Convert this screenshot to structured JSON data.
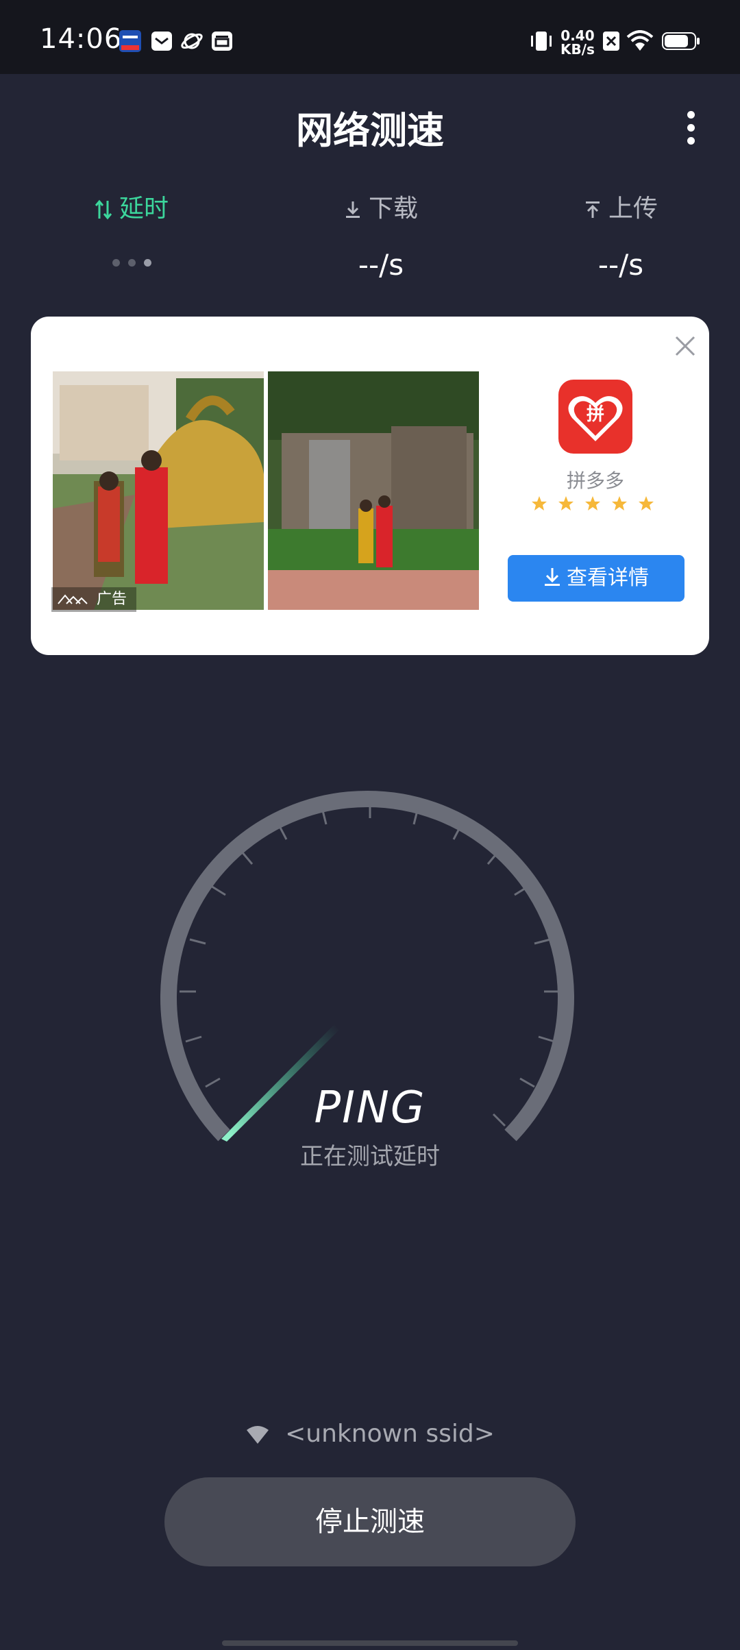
{
  "status_bar": {
    "time": "14:06",
    "speed_value": "0.40",
    "speed_unit": "KB/s",
    "left_icons": [
      "news-app-icon",
      "mail-icon",
      "planet-icon",
      "wallet-icon"
    ],
    "right_icons": [
      "vibrate-icon",
      "no-sim-icon",
      "wifi-icon",
      "battery-icon"
    ]
  },
  "header": {
    "title": "网络测速",
    "menu_icon": "more-vertical-icon"
  },
  "metrics": {
    "latency": {
      "label": "延时",
      "icon": "arrows-up-down-icon"
    },
    "download": {
      "label": "下载",
      "value": "--/s",
      "icon": "download-icon"
    },
    "upload": {
      "label": "上传",
      "value": "--/s",
      "icon": "upload-icon"
    },
    "active_color": "#3cd69c"
  },
  "ad": {
    "badge": "广告",
    "app_name": "拼多多",
    "rating": 5,
    "cta_label": "查看详情",
    "icon_char": "拼",
    "cta_color": "#2b86f0"
  },
  "gauge": {
    "title": "PING",
    "status": "正在测试延时"
  },
  "network": {
    "ssid": "<unknown ssid>"
  },
  "action": {
    "stop_label": "停止测速"
  }
}
